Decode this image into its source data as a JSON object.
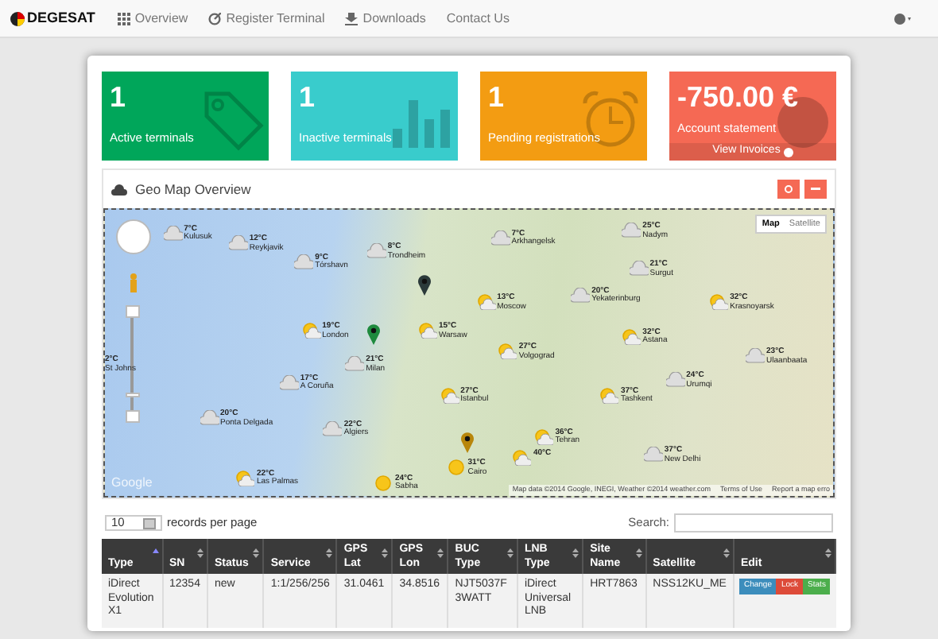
{
  "navbar": {
    "brand": "DEGESAT",
    "items": [
      {
        "label": "Overview"
      },
      {
        "label": "Register Terminal"
      },
      {
        "label": "Downloads"
      },
      {
        "label": "Contact Us"
      }
    ]
  },
  "tiles": [
    {
      "value": "1",
      "label": "Active terminals",
      "color": "#00a65a"
    },
    {
      "value": "1",
      "label": "Inactive terminals",
      "color": "#39cccc"
    },
    {
      "value": "1",
      "label": "Pending registrations",
      "color": "#f39c12"
    },
    {
      "value": "-750.00 €",
      "label": "Account statement",
      "color": "#f56954",
      "link": "View Invoices"
    }
  ],
  "map_panel": {
    "title": "Geo Map Overview",
    "zoom": {
      "level": 0.15
    },
    "map_types": [
      {
        "label": "Map",
        "selected": true
      },
      {
        "label": "Satellite",
        "selected": false
      }
    ],
    "logo": "Google",
    "attribution": "Map data ©2014 Google, INEGI, Weather ©2014 weather.com",
    "terms": "Terms of Use",
    "report": "Report a map erro",
    "weather": [
      {
        "temp": "7°C",
        "city": "Kulusuk",
        "kind": "cloud"
      },
      {
        "temp": "12°C",
        "city": "Reykjavik",
        "kind": "cloud"
      },
      {
        "temp": "9°C",
        "city": "Tórshavn",
        "kind": "cloud"
      },
      {
        "temp": "8°C",
        "city": "Trondheim",
        "kind": "cloud"
      },
      {
        "temp": "7°C",
        "city": "Arkhangelsk",
        "kind": "cloud"
      },
      {
        "temp": "25°C",
        "city": "Nadym",
        "kind": "cloud"
      },
      {
        "temp": "21°C",
        "city": "Surgut",
        "kind": "cloud"
      },
      {
        "temp": "13°C",
        "city": "Moscow",
        "kind": "partly"
      },
      {
        "temp": "20°C",
        "city": "Yekaterinburg",
        "kind": "cloud"
      },
      {
        "temp": "32°C",
        "city": "Krasnoyarsk",
        "kind": "partly"
      },
      {
        "temp": "19°C",
        "city": "London",
        "kind": "partly"
      },
      {
        "temp": "15°C",
        "city": "Warsaw",
        "kind": "partly"
      },
      {
        "temp": "32°C",
        "city": "Astana",
        "kind": "partly"
      },
      {
        "temp": "27°C",
        "city": "Volgograd",
        "kind": "partly"
      },
      {
        "temp": "2°C",
        "city": "St Johns",
        "kind": "none"
      },
      {
        "temp": "23°C",
        "city": "Ulaanbaata",
        "kind": "cloud"
      },
      {
        "temp": "24°C",
        "city": "Urumqi",
        "kind": "cloud"
      },
      {
        "temp": "21°C",
        "city": "Milan",
        "kind": "cloud"
      },
      {
        "temp": "17°C",
        "city": "A Coruña",
        "kind": "cloud"
      },
      {
        "temp": "27°C",
        "city": "Istanbul",
        "kind": "partly"
      },
      {
        "temp": "37°C",
        "city": "Tashkent",
        "kind": "partly"
      },
      {
        "temp": "20°C",
        "city": "Ponta Delgada",
        "kind": "cloud"
      },
      {
        "temp": "22°C",
        "city": "Algiers",
        "kind": "cloud"
      },
      {
        "temp": "36°C",
        "city": "Tehran",
        "kind": "partly"
      },
      {
        "temp": "37°C",
        "city": "New Delhi",
        "kind": "cloud"
      },
      {
        "temp": "22°C",
        "city": "Las Palmas",
        "kind": "partly"
      },
      {
        "temp": "24°C",
        "city": "Sabha",
        "kind": "sun"
      },
      {
        "temp": "31°C",
        "city": "Cairo",
        "kind": "sun"
      },
      {
        "temp": "40°C",
        "kind": "partly"
      }
    ],
    "pins": [
      {
        "color": "#1f8a3e"
      },
      {
        "color": "#2b3a3a"
      },
      {
        "color": "#b8860b"
      }
    ]
  },
  "table": {
    "page_size": "10",
    "page_size_label": "records per page",
    "search_label": "Search:",
    "columns": [
      {
        "label": "Type",
        "sorted": true
      },
      {
        "label": "SN",
        "sorted": false
      },
      {
        "label": "Status",
        "sorted": false
      },
      {
        "label": "Service",
        "sorted": false
      },
      {
        "label": "GPS Lat",
        "sorted": false
      },
      {
        "label": "GPS Lon",
        "sorted": false
      },
      {
        "label": "BUC Type",
        "sorted": false
      },
      {
        "label": "LNB Type",
        "sorted": false
      },
      {
        "label": "Site Name",
        "sorted": false
      },
      {
        "label": "Satellite",
        "sorted": false
      },
      {
        "label": "Edit",
        "sorted": false
      }
    ],
    "rows": [
      {
        "cells": [
          "iDirect Evolution X1",
          "12354",
          "new",
          "1:1/256/256",
          "31.0461",
          "34.8516",
          "NJT5037F 3WATT",
          "iDirect Universal LNB",
          "HRT7863",
          "NSS12KU_ME"
        ],
        "actions": [
          {
            "label": "Change",
            "color": "#3c8dbc"
          },
          {
            "label": "Lock",
            "color": "#dd4b39"
          },
          {
            "label": "Stats",
            "color": "#4cae4c"
          }
        ]
      }
    ]
  }
}
